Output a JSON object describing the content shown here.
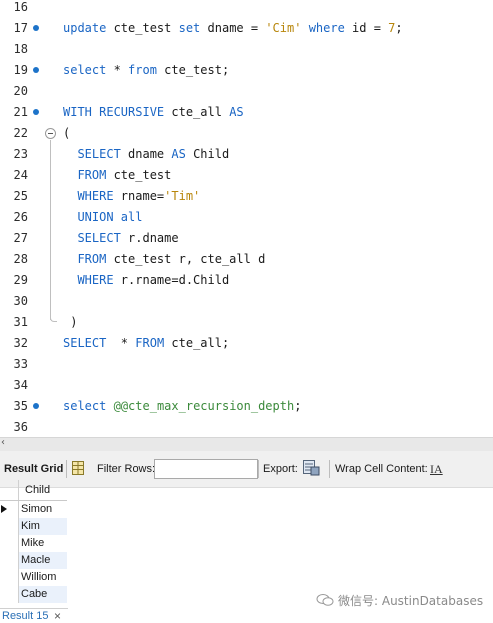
{
  "editor": {
    "lines": [
      {
        "n": "16",
        "dot": false,
        "tokens": []
      },
      {
        "n": "17",
        "dot": true,
        "tokens": [
          [
            "kw",
            "update"
          ],
          [
            "plain",
            " cte_test "
          ],
          [
            "kw",
            "set"
          ],
          [
            "plain",
            " dname = "
          ],
          [
            "str",
            "'Cim'"
          ],
          [
            "plain",
            " "
          ],
          [
            "kw",
            "where"
          ],
          [
            "plain",
            " id = "
          ],
          [
            "num",
            "7"
          ],
          [
            "plain",
            ";"
          ]
        ]
      },
      {
        "n": "18",
        "dot": false,
        "tokens": []
      },
      {
        "n": "19",
        "dot": true,
        "tokens": [
          [
            "kw",
            "select"
          ],
          [
            "plain",
            " * "
          ],
          [
            "kw",
            "from"
          ],
          [
            "plain",
            " cte_test;"
          ]
        ]
      },
      {
        "n": "20",
        "dot": false,
        "tokens": []
      },
      {
        "n": "21",
        "dot": true,
        "tokens": [
          [
            "kw",
            "WITH RECURSIVE"
          ],
          [
            "plain",
            " cte_all "
          ],
          [
            "kw",
            "AS"
          ]
        ]
      },
      {
        "n": "22",
        "dot": false,
        "tokens": [
          [
            "plain",
            "("
          ]
        ]
      },
      {
        "n": "23",
        "dot": false,
        "tokens": [
          [
            "plain",
            "  "
          ],
          [
            "kw",
            "SELECT"
          ],
          [
            "plain",
            " dname "
          ],
          [
            "kw",
            "AS"
          ],
          [
            "plain",
            " Child"
          ]
        ]
      },
      {
        "n": "24",
        "dot": false,
        "tokens": [
          [
            "plain",
            "  "
          ],
          [
            "kw",
            "FROM"
          ],
          [
            "plain",
            " cte_test"
          ]
        ]
      },
      {
        "n": "25",
        "dot": false,
        "tokens": [
          [
            "plain",
            "  "
          ],
          [
            "kw",
            "WHERE"
          ],
          [
            "plain",
            " rname="
          ],
          [
            "str",
            "'Tim'"
          ]
        ]
      },
      {
        "n": "26",
        "dot": false,
        "tokens": [
          [
            "plain",
            "  "
          ],
          [
            "kw",
            "UNION all"
          ]
        ]
      },
      {
        "n": "27",
        "dot": false,
        "tokens": [
          [
            "plain",
            "  "
          ],
          [
            "kw",
            "SELECT"
          ],
          [
            "plain",
            " r.dname"
          ]
        ]
      },
      {
        "n": "28",
        "dot": false,
        "tokens": [
          [
            "plain",
            "  "
          ],
          [
            "kw",
            "FROM"
          ],
          [
            "plain",
            " cte_test r, cte_all d"
          ]
        ]
      },
      {
        "n": "29",
        "dot": false,
        "tokens": [
          [
            "plain",
            "  "
          ],
          [
            "kw",
            "WHERE"
          ],
          [
            "plain",
            " r.rname=d.Child"
          ]
        ]
      },
      {
        "n": "30",
        "dot": false,
        "tokens": []
      },
      {
        "n": "31",
        "dot": false,
        "tokens": [
          [
            "plain",
            " )"
          ]
        ]
      },
      {
        "n": "32",
        "dot": false,
        "tokens": [
          [
            "kw",
            "SELECT"
          ],
          [
            "plain",
            "  * "
          ],
          [
            "kw",
            "FROM"
          ],
          [
            "plain",
            " cte_all;"
          ]
        ]
      },
      {
        "n": "33",
        "dot": false,
        "tokens": []
      },
      {
        "n": "34",
        "dot": false,
        "tokens": []
      },
      {
        "n": "35",
        "dot": true,
        "tokens": [
          [
            "kw",
            "select"
          ],
          [
            "plain",
            " "
          ],
          [
            "var",
            "@@cte_max_recursion_depth"
          ],
          [
            "plain",
            ";"
          ]
        ]
      },
      {
        "n": "36",
        "dot": false,
        "tokens": []
      }
    ]
  },
  "toolbar": {
    "result_grid_label": "Result Grid",
    "filter_rows_label": "Filter Rows:",
    "filter_rows_value": "",
    "export_label": "Export:",
    "wrap_label": "Wrap Cell Content:",
    "wrap_icon": "IA"
  },
  "grid": {
    "column": "Child",
    "rows": [
      "Simon",
      "Kim",
      "Mike",
      "Macle",
      "Williom",
      "Cabe"
    ]
  },
  "result_tab": {
    "label": "Result 15",
    "close": "×"
  },
  "watermark": {
    "text": "微信号: AustinDatabases"
  },
  "colors": {
    "keyword": "#1a65c4",
    "string": "#b8860b",
    "variable": "#3b8a3b",
    "marker": "#1d73c9"
  }
}
